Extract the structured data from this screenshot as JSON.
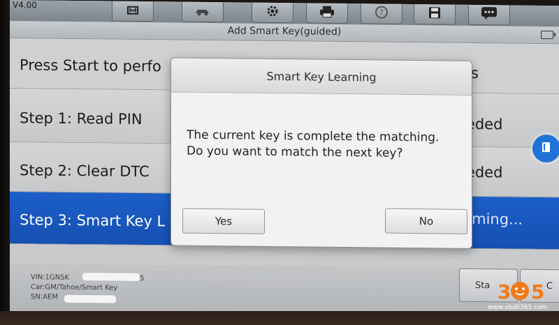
{
  "toolbar": {
    "version": "V4.00",
    "icons": [
      "home-icon",
      "vehicle-icon",
      "settings-icon",
      "print-icon",
      "help-icon",
      "save-icon",
      "message-icon"
    ]
  },
  "header": {
    "title": "Add Smart Key(guided)"
  },
  "rows": {
    "intro": {
      "label": "Press Start to perfo",
      "status": "s"
    },
    "step1": {
      "label": "Step 1: Read PIN",
      "status": "eeded"
    },
    "step2": {
      "label": "Step 2: Clear DTC",
      "status": "eeded"
    },
    "step3": {
      "label": "Step 3: Smart Key L",
      "status": "orming..."
    }
  },
  "footer": {
    "vin": "VIN:1GNSK",
    "vin_tail": "5",
    "car": "Car:GM/Tahoe/Smart Key",
    "sn": "SN:AEM",
    "start_label": "Sta",
    "esc_label": "C"
  },
  "dialog": {
    "title": "Smart Key Learning",
    "message_line1": "The current key is complete the matching.",
    "message_line2": "Do you want to match the next key?",
    "yes_label": "Yes",
    "no_label": "No"
  },
  "watermark": {
    "digits_left": "3",
    "digits_right": "5",
    "site": "www.obdii365.com",
    "accent": "#f07a1a"
  },
  "colors": {
    "selected_row": "#1c5fc8",
    "help_fab": "#1f73d6"
  }
}
